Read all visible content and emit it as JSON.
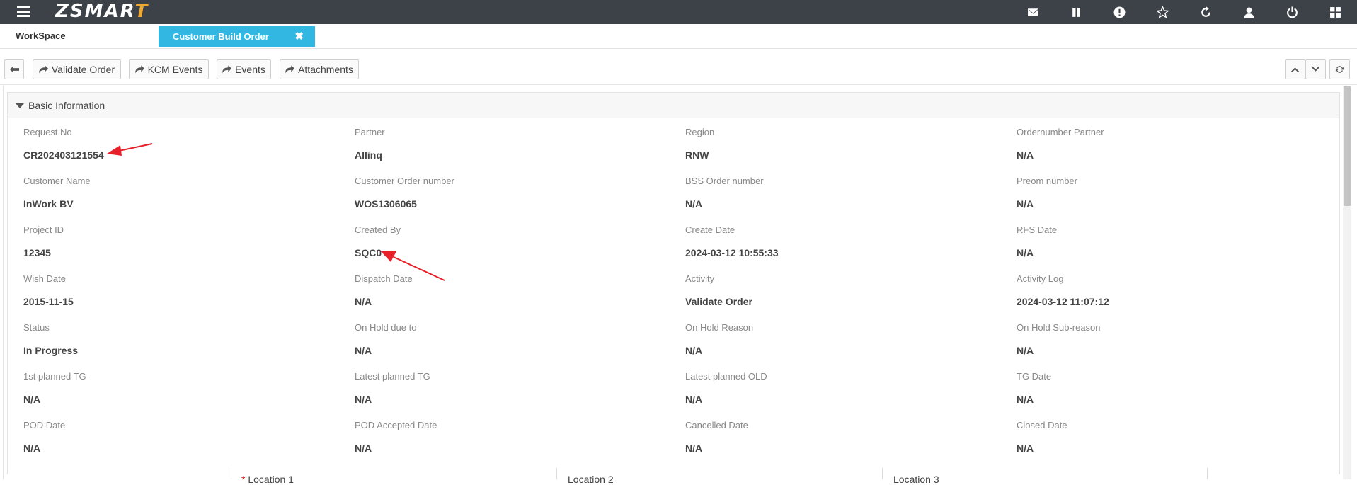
{
  "app": {
    "logo_main": "ZSMAR",
    "logo_accent": "T",
    "brand_accent_color": "#f0a830",
    "topbar_color": "#3d4148",
    "tab_color": "#32b7e2",
    "top_icons": [
      "mail-icon",
      "pause-icon",
      "alert-icon",
      "star-icon",
      "refresh-icon",
      "user-icon",
      "power-icon",
      "grid-icon"
    ]
  },
  "tabs": {
    "workspace": "WorkSpace",
    "active": "Customer Build Order",
    "close_glyph": "✖"
  },
  "toolbar": {
    "validate_order": "Validate Order",
    "kcm_events": "KCM Events",
    "events": "Events",
    "attachments": "Attachments"
  },
  "panel": {
    "title": "Basic Information"
  },
  "fields": [
    [
      {
        "label": "Request No",
        "value": "CR202403121554"
      },
      {
        "label": "Partner",
        "value": "Allinq"
      },
      {
        "label": "Region",
        "value": "RNW"
      },
      {
        "label": "Ordernumber Partner",
        "value": "N/A"
      }
    ],
    [
      {
        "label": "Customer Name",
        "value": "InWork BV"
      },
      {
        "label": "Customer Order number",
        "value": "WOS1306065"
      },
      {
        "label": "BSS Order number",
        "value": "N/A"
      },
      {
        "label": "Preom number",
        "value": "N/A"
      }
    ],
    [
      {
        "label": "Project ID",
        "value": "12345"
      },
      {
        "label": "Created By",
        "value": "SQC0"
      },
      {
        "label": "Create Date",
        "value": "2024-03-12 10:55:33"
      },
      {
        "label": "RFS Date",
        "value": "N/A"
      }
    ],
    [
      {
        "label": "Wish Date",
        "value": "2015-11-15"
      },
      {
        "label": "Dispatch Date",
        "value": "N/A"
      },
      {
        "label": "Activity",
        "value": "Validate Order"
      },
      {
        "label": "Activity Log",
        "value": "2024-03-12 11:07:12"
      }
    ],
    [
      {
        "label": "Status",
        "value": "In Progress"
      },
      {
        "label": "On Hold due to",
        "value": "N/A"
      },
      {
        "label": "On Hold Reason",
        "value": "N/A"
      },
      {
        "label": "On Hold Sub-reason",
        "value": "N/A"
      }
    ],
    [
      {
        "label": "1st planned TG",
        "value": "N/A"
      },
      {
        "label": "Latest planned TG",
        "value": "N/A"
      },
      {
        "label": "Latest planned OLD",
        "value": "N/A"
      },
      {
        "label": "TG Date",
        "value": "N/A"
      }
    ],
    [
      {
        "label": "POD Date",
        "value": "N/A"
      },
      {
        "label": "POD Accepted Date",
        "value": "N/A"
      },
      {
        "label": "Cancelled Date",
        "value": "N/A"
      },
      {
        "label": "Closed Date",
        "value": "N/A"
      }
    ]
  ],
  "locations": {
    "required_mark": "*",
    "location1": "Location 1",
    "location2": "Location 2",
    "location3": "Location 3"
  },
  "annotation_color": "#e8202a"
}
